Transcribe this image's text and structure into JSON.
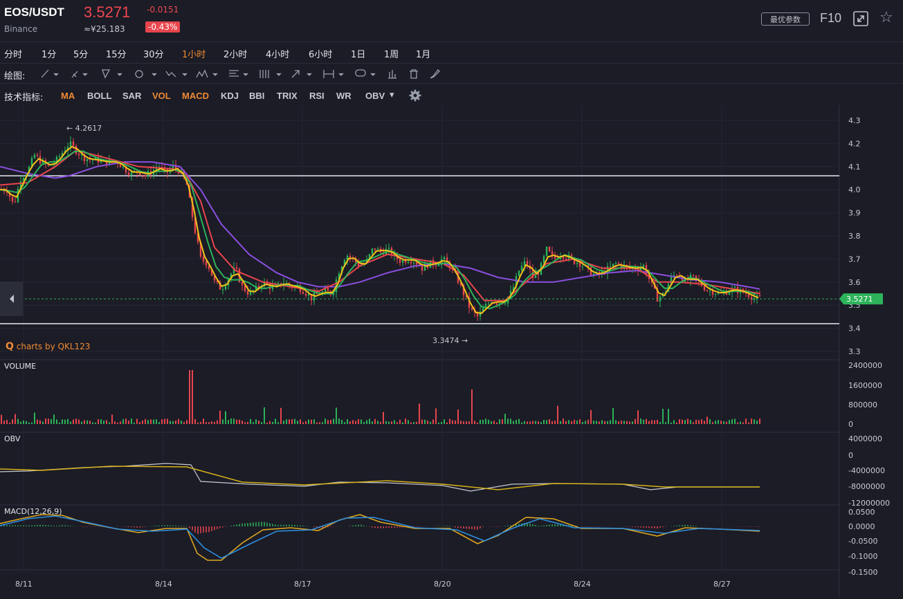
{
  "header": {
    "pair": "EOS/USDT",
    "exchange": "Binance",
    "price": "3.5271",
    "cny": "≈¥25.183",
    "change": "-0.0151",
    "change_pct": "-0.43%",
    "best_params": "最优参数",
    "f10": "F10",
    "icons": [
      "expand-icon",
      "star-icon"
    ]
  },
  "timeframes": [
    "分时",
    "1分",
    "5分",
    "15分",
    "30分",
    "1小时",
    "2小时",
    "4小时",
    "6小时",
    "1日",
    "1周",
    "1月"
  ],
  "active_timeframe": "1小时",
  "drawing": {
    "label": "绘图:",
    "tools": [
      "line-tool-icon",
      "pencil-tool-icon",
      "fork-tool-icon",
      "shape-tool-icon",
      "pattern-tool-icon",
      "position-tool-icon",
      "fib-tool-icon",
      "gann-tool-icon",
      "arrow-tool-icon",
      "measure-tool-icon",
      "comment-tool-icon",
      "bar-tool-icon",
      "trash-icon",
      "brush-icon"
    ]
  },
  "indicators": {
    "label": "技术指标:",
    "items": [
      "MA",
      "BOLL",
      "SAR",
      "VOL",
      "MACD",
      "KDJ",
      "BBI",
      "TRIX",
      "RSI",
      "WR",
      "OBV"
    ],
    "active": [
      "MA",
      "VOL",
      "MACD"
    ],
    "obv_dropdown": "▾"
  },
  "chart_data": {
    "type": "candlestick",
    "x_labels": [
      "8/11",
      "8/14",
      "8/17",
      "8/20",
      "8/24",
      "8/27"
    ],
    "price_axis": [
      "4.3",
      "4.2",
      "4.1",
      "4.0",
      "3.9",
      "3.8",
      "3.7",
      "3.6",
      "3.5",
      "3.4",
      "3.3"
    ],
    "ylim": [
      3.3,
      4.3
    ],
    "high_marker": "4.2617",
    "low_marker": "3.3474",
    "current_price": "3.5271",
    "horizontal_lines": [
      4.06,
      3.42
    ],
    "watermark": "charts by QKL123",
    "colors": {
      "up": "#2db35a",
      "down": "#e8454d",
      "ma5": "#f2c31a",
      "ma10": "#2db35a",
      "ma20": "#e8454d",
      "ma60": "#8b4fe0",
      "current": "#2db35a"
    },
    "close_path": [
      [
        0,
        4.0
      ],
      [
        10,
        4.0
      ],
      [
        20,
        3.93
      ],
      [
        30,
        4.05
      ],
      [
        40,
        4.08
      ],
      [
        50,
        4.15
      ],
      [
        60,
        4.12
      ],
      [
        70,
        4.1
      ],
      [
        80,
        4.12
      ],
      [
        90,
        4.16
      ],
      [
        100,
        4.2
      ],
      [
        110,
        4.17
      ],
      [
        120,
        4.14
      ],
      [
        130,
        4.13
      ],
      [
        140,
        4.13
      ],
      [
        150,
        4.12
      ],
      [
        160,
        4.12
      ],
      [
        170,
        4.12
      ],
      [
        180,
        4.09
      ],
      [
        190,
        4.07
      ],
      [
        200,
        4.08
      ],
      [
        210,
        4.06
      ],
      [
        220,
        4.08
      ],
      [
        230,
        4.1
      ],
      [
        240,
        4.07
      ],
      [
        250,
        4.1
      ],
      [
        260,
        4.08
      ],
      [
        270,
        4.02
      ],
      [
        280,
        3.85
      ],
      [
        290,
        3.7
      ],
      [
        300,
        3.68
      ],
      [
        310,
        3.6
      ],
      [
        320,
        3.57
      ],
      [
        330,
        3.62
      ],
      [
        340,
        3.66
      ],
      [
        350,
        3.58
      ],
      [
        360,
        3.55
      ],
      [
        370,
        3.57
      ],
      [
        380,
        3.6
      ],
      [
        390,
        3.58
      ],
      [
        400,
        3.58
      ],
      [
        410,
        3.6
      ],
      [
        420,
        3.58
      ],
      [
        430,
        3.58
      ],
      [
        440,
        3.56
      ],
      [
        450,
        3.53
      ],
      [
        460,
        3.55
      ],
      [
        470,
        3.56
      ],
      [
        480,
        3.55
      ],
      [
        490,
        3.65
      ],
      [
        500,
        3.72
      ],
      [
        510,
        3.7
      ],
      [
        520,
        3.67
      ],
      [
        530,
        3.69
      ],
      [
        540,
        3.75
      ],
      [
        550,
        3.73
      ],
      [
        560,
        3.74
      ],
      [
        570,
        3.71
      ],
      [
        580,
        3.69
      ],
      [
        590,
        3.7
      ],
      [
        600,
        3.69
      ],
      [
        610,
        3.66
      ],
      [
        620,
        3.68
      ],
      [
        630,
        3.68
      ],
      [
        640,
        3.7
      ],
      [
        650,
        3.67
      ],
      [
        660,
        3.62
      ],
      [
        670,
        3.55
      ],
      [
        680,
        3.48
      ],
      [
        690,
        3.45
      ],
      [
        700,
        3.49
      ],
      [
        710,
        3.52
      ],
      [
        720,
        3.51
      ],
      [
        730,
        3.52
      ],
      [
        740,
        3.56
      ],
      [
        750,
        3.65
      ],
      [
        760,
        3.69
      ],
      [
        770,
        3.62
      ],
      [
        780,
        3.65
      ],
      [
        790,
        3.74
      ],
      [
        800,
        3.7
      ],
      [
        810,
        3.72
      ],
      [
        820,
        3.71
      ],
      [
        830,
        3.69
      ],
      [
        840,
        3.68
      ],
      [
        850,
        3.65
      ],
      [
        860,
        3.63
      ],
      [
        870,
        3.64
      ],
      [
        880,
        3.66
      ],
      [
        890,
        3.68
      ],
      [
        900,
        3.67
      ],
      [
        910,
        3.66
      ],
      [
        920,
        3.66
      ],
      [
        930,
        3.67
      ],
      [
        940,
        3.6
      ],
      [
        950,
        3.53
      ],
      [
        960,
        3.55
      ],
      [
        970,
        3.62
      ],
      [
        980,
        3.64
      ],
      [
        990,
        3.6
      ],
      [
        1000,
        3.62
      ],
      [
        1010,
        3.6
      ],
      [
        1020,
        3.57
      ],
      [
        1030,
        3.56
      ],
      [
        1040,
        3.55
      ],
      [
        1050,
        3.56
      ],
      [
        1060,
        3.57
      ],
      [
        1070,
        3.56
      ],
      [
        1080,
        3.55
      ],
      [
        1090,
        3.53
      ],
      [
        1098,
        3.53
      ]
    ],
    "ma60_path": [
      [
        0,
        4.1
      ],
      [
        40,
        4.07
      ],
      [
        80,
        4.05
      ],
      [
        100,
        4.06
      ],
      [
        140,
        4.1
      ],
      [
        180,
        4.12
      ],
      [
        220,
        4.12
      ],
      [
        260,
        4.1
      ],
      [
        290,
        4.0
      ],
      [
        320,
        3.85
      ],
      [
        360,
        3.72
      ],
      [
        400,
        3.64
      ],
      [
        430,
        3.6
      ],
      [
        460,
        3.58
      ],
      [
        490,
        3.58
      ],
      [
        520,
        3.6
      ],
      [
        560,
        3.64
      ],
      [
        600,
        3.67
      ],
      [
        640,
        3.68
      ],
      [
        680,
        3.66
      ],
      [
        720,
        3.62
      ],
      [
        760,
        3.6
      ],
      [
        800,
        3.6
      ],
      [
        840,
        3.62
      ],
      [
        880,
        3.64
      ],
      [
        920,
        3.65
      ],
      [
        960,
        3.63
      ],
      [
        1000,
        3.61
      ],
      [
        1040,
        3.6
      ],
      [
        1080,
        3.58
      ],
      [
        1098,
        3.57
      ]
    ],
    "ma20_path": [
      [
        0,
        4.02
      ],
      [
        40,
        4.03
      ],
      [
        80,
        4.1
      ],
      [
        110,
        4.17
      ],
      [
        150,
        4.14
      ],
      [
        200,
        4.1
      ],
      [
        250,
        4.09
      ],
      [
        270,
        4.06
      ],
      [
        290,
        3.95
      ],
      [
        310,
        3.75
      ],
      [
        340,
        3.65
      ],
      [
        380,
        3.6
      ],
      [
        420,
        3.58
      ],
      [
        460,
        3.56
      ],
      [
        490,
        3.6
      ],
      [
        520,
        3.67
      ],
      [
        560,
        3.72
      ],
      [
        600,
        3.7
      ],
      [
        640,
        3.68
      ],
      [
        670,
        3.63
      ],
      [
        700,
        3.52
      ],
      [
        730,
        3.52
      ],
      [
        760,
        3.6
      ],
      [
        790,
        3.68
      ],
      [
        830,
        3.7
      ],
      [
        870,
        3.66
      ],
      [
        920,
        3.66
      ],
      [
        950,
        3.6
      ],
      [
        980,
        3.6
      ],
      [
        1020,
        3.59
      ],
      [
        1060,
        3.57
      ],
      [
        1098,
        3.55
      ]
    ],
    "volume": {
      "axis": [
        "2400000",
        "1600000",
        "800000",
        "0"
      ],
      "label": "VOLUME"
    },
    "obv": {
      "axis": [
        "4000000",
        "0",
        "-4000000",
        "-8000000",
        "-12000000"
      ],
      "label": "OBV"
    },
    "macd": {
      "axis": [
        "0.0500",
        "0.0000",
        "-0.0500",
        "-0.1000",
        "-0.1500"
      ],
      "label": "MACD(12,26,9)"
    }
  }
}
